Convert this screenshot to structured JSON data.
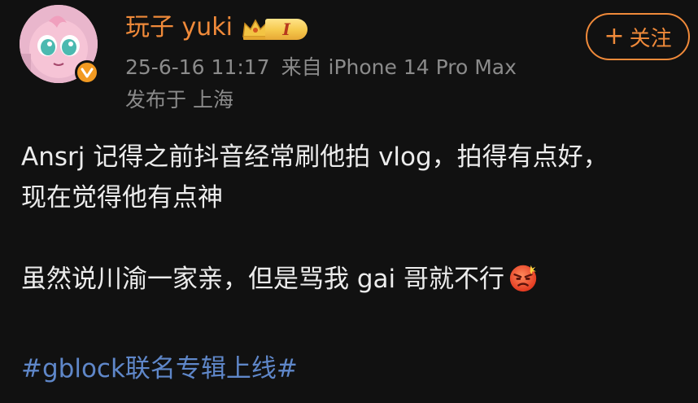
{
  "author": {
    "name": "玩子 yuki",
    "level_badge": "I",
    "crown_icon": "crown-icon",
    "verified_icon": "verified-v-icon",
    "accent_color": "#f08a3a"
  },
  "meta": {
    "datetime": "25-6-16 11:17",
    "source": "来自 iPhone 14 Pro Max",
    "location": "发布于 上海"
  },
  "follow_button": {
    "icon": "plus-icon",
    "label": "关注"
  },
  "post": {
    "paragraph1_line1": "Ansrj 记得之前抖音经常刷他拍 vlog，拍得有点好，",
    "paragraph1_line2": "现在觉得他有点神",
    "paragraph2": "虽然说川渝一家亲，但是骂我 gai 哥就不行",
    "emoji": "angry-face-emoji",
    "hashtag": "#gblock联名专辑上线#",
    "hashtag_color": "#5f87c9"
  }
}
